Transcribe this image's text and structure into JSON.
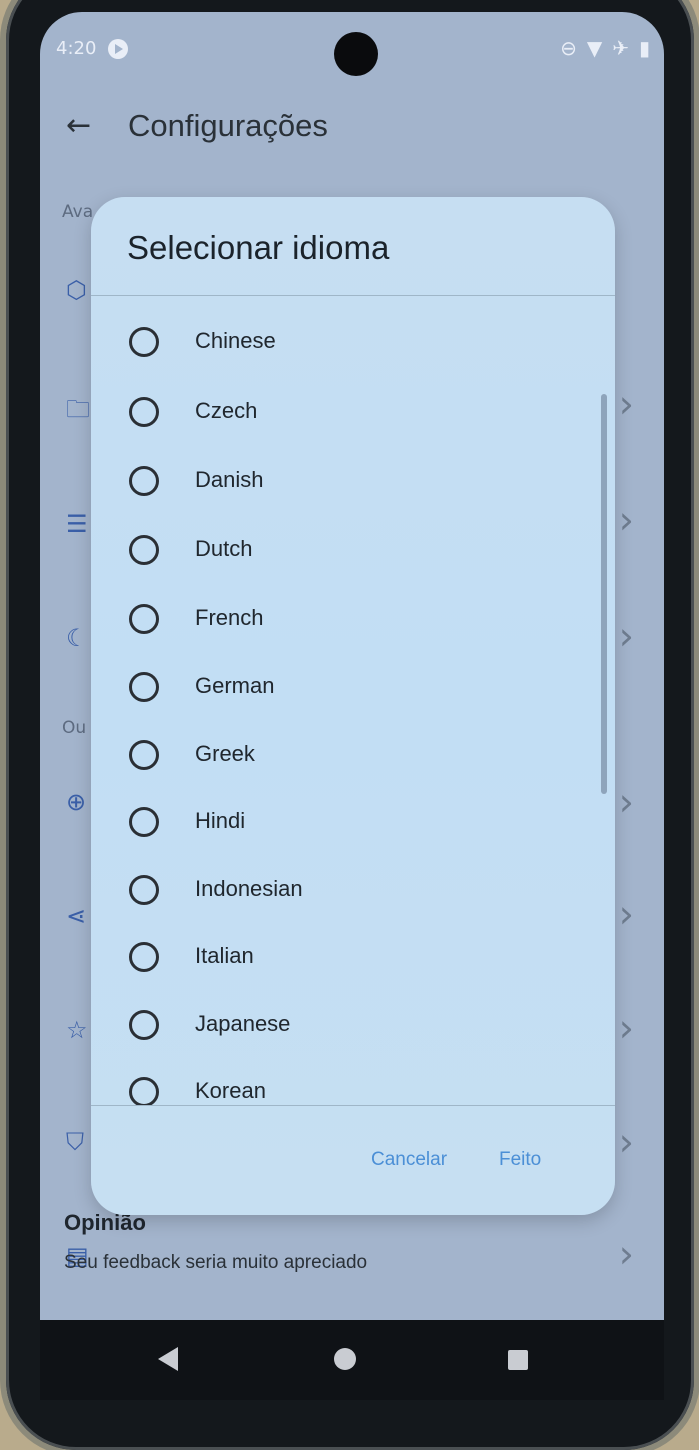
{
  "status_bar": {
    "time": "4:20",
    "icons": [
      "do-not-disturb-icon",
      "wifi-icon",
      "airplane-icon",
      "battery-icon"
    ]
  },
  "app_bar": {
    "title": "Configurações",
    "back_icon": "arrow-left-icon"
  },
  "background": {
    "section_labels": [
      "Ava",
      "Ou"
    ],
    "opinion_title": "Opinião",
    "opinion_subtitle": "Seu feedback seria muito apreciado"
  },
  "dialog": {
    "title": "Selecionar idioma",
    "options": [
      {
        "label": "Chinese",
        "selected": false
      },
      {
        "label": "Czech",
        "selected": false
      },
      {
        "label": "Danish",
        "selected": false
      },
      {
        "label": "Dutch",
        "selected": false
      },
      {
        "label": "French",
        "selected": false
      },
      {
        "label": "German",
        "selected": false
      },
      {
        "label": "Greek",
        "selected": false
      },
      {
        "label": "Hindi",
        "selected": false
      },
      {
        "label": "Indonesian",
        "selected": false
      },
      {
        "label": "Italian",
        "selected": false
      },
      {
        "label": "Japanese",
        "selected": false
      },
      {
        "label": "Korean",
        "selected": false
      }
    ],
    "cancel_label": "Cancelar",
    "done_label": "Feito"
  },
  "colors": {
    "accent": "#4b8fd6",
    "dialog_bg": "#c4def3",
    "scrim_bg": "#a3b4cc"
  }
}
